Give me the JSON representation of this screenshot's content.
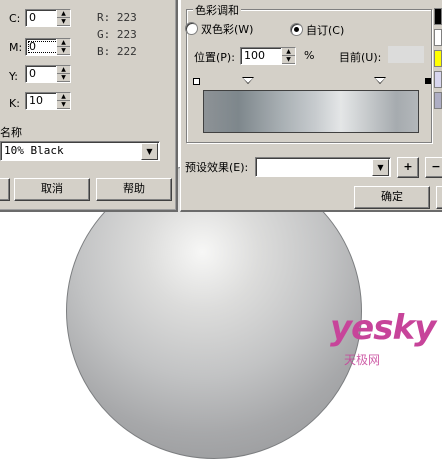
{
  "cmyk": {
    "c_label": "C:",
    "c_value": "0",
    "m_label": "M:",
    "m_value": "0",
    "y_label": "Y:",
    "y_value": "0",
    "k_label": "K:",
    "k_value": "10"
  },
  "rgb": {
    "r": "R: 223",
    "g": "G: 223",
    "b": "B: 222"
  },
  "name_field": {
    "label": "名称",
    "value": "10% Black"
  },
  "left_buttons": {
    "cancel": "取消",
    "help": "帮助"
  },
  "blend": {
    "group_title": "色彩调和",
    "two_color_label": "双色彩(W)",
    "custom_label": "自订(C)",
    "selected": "custom",
    "position_label": "位置(P):",
    "position_value": "100",
    "position_unit": "%",
    "current_label": "目前(U):"
  },
  "presets": {
    "label": "预设效果(E):",
    "value": "",
    "add": "+",
    "remove": "−"
  },
  "right_buttons": {
    "ok": "确定"
  },
  "palette_colors": [
    "#000000",
    "#ffffff",
    "#ffff00",
    "#d8d6ee",
    "#aeaec4"
  ],
  "watermark": {
    "logo": "yesky",
    "sub": "天极网"
  }
}
